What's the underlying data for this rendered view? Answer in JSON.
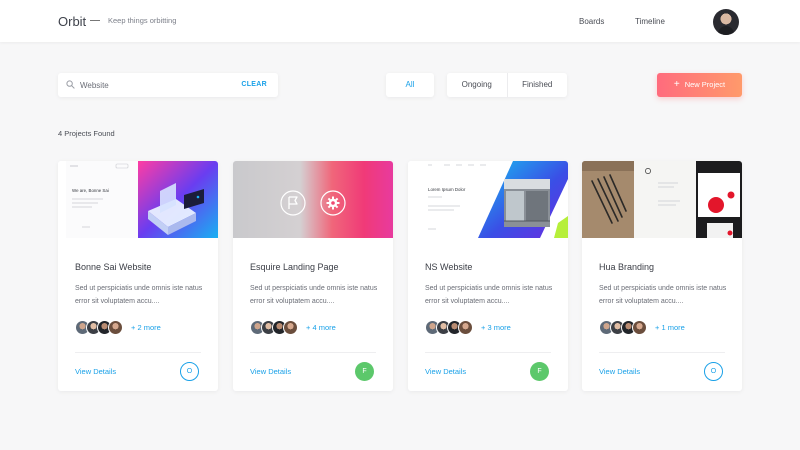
{
  "header": {
    "brand": "Orbit",
    "tagline": "Keep things orbitting",
    "nav": [
      "Boards",
      "Timeline"
    ]
  },
  "toolbar": {
    "search_value": "Website",
    "clear_label": "CLEAR",
    "filters": [
      "All",
      "Ongoing",
      "Finished"
    ],
    "active_filter": "All",
    "new_project_label": "New Project",
    "new_project_icon": "plus-icon"
  },
  "results_label": "4 Projects Found",
  "colors": {
    "accent": "#1aa1e8",
    "new_project_gradient": [
      "#ff6b7d",
      "#ff9a6b"
    ],
    "finished": "#5cc86b"
  },
  "projects": [
    {
      "title": "Bonne Sai Website",
      "description": "Sed ut perspiciatis unde omnis iste natus error sit voluptatem accu....",
      "more": "+ 2 more",
      "action": "View Details",
      "status_letter": "O",
      "status": "open"
    },
    {
      "title": "Esquire Landing Page",
      "description": "Sed ut perspiciatis unde omnis iste natus error sit voluptatem accu....",
      "more": "+ 4 more",
      "action": "View Details",
      "status_letter": "F",
      "status": "finished"
    },
    {
      "title": "NS Website",
      "description": "Sed ut perspiciatis unde omnis iste natus error sit voluptatem accu....",
      "more": "+ 3 more",
      "action": "View Details",
      "status_letter": "F",
      "status": "finished"
    },
    {
      "title": "Hua Branding",
      "description": "Sed ut perspiciatis unde omnis iste natus error sit voluptatem accu....",
      "more": "+ 1 more",
      "action": "View Details",
      "status_letter": "O",
      "status": "open"
    }
  ],
  "thumb_text": {
    "bonne_heading": "We are, Bonne Sai",
    "ns_heading": "Lorem Ipsum Dolor"
  }
}
